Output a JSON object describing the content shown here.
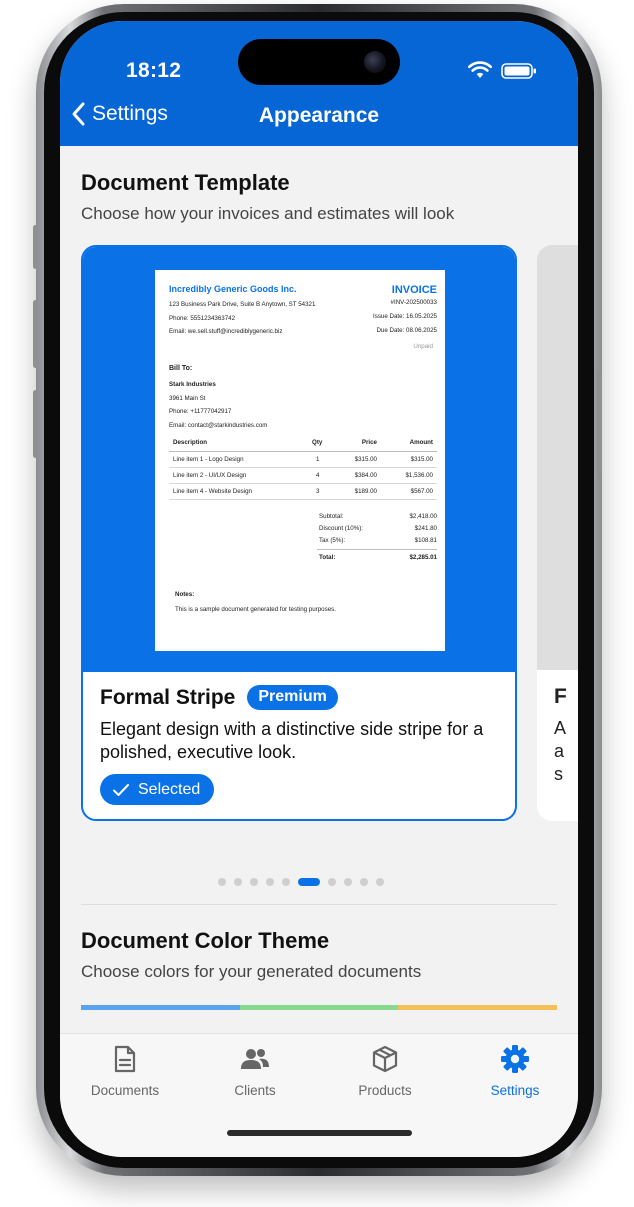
{
  "status": {
    "time": "18:12"
  },
  "nav": {
    "back_label": "Settings",
    "title": "Appearance"
  },
  "template_section": {
    "title": "Document Template",
    "subtitle": "Choose how your invoices and estimates will look"
  },
  "card": {
    "name": "Formal Stripe",
    "badge": "Premium",
    "description": "Elegant design with a distinctive side stripe for a polished, executive look.",
    "selected_label": "Selected",
    "next_card_fragments": [
      "F",
      "A",
      "a",
      "s"
    ]
  },
  "invoice": {
    "company": "Incredibly Generic Goods Inc.",
    "address": "123 Business Park Drive, Suite B Anytown, ST 54321",
    "phone": "Phone: 5551234363742",
    "email": "Email: we.sell.stuff@incrediblygeneric.biz",
    "title": "INVOICE",
    "number": "#INV-202500033",
    "issue_date": "Issue Date: 16.05.2025",
    "due_date": "Due Date: 08.06.2025",
    "status": "Unpaid",
    "bill_to_label": "Bill To:",
    "client_name": "Stark Industries",
    "client_address": "3961 Main St",
    "client_phone": "Phone: +11777042917",
    "client_email": "Email: contact@starkindustries.com",
    "headers": {
      "description": "Description",
      "qty": "Qty",
      "price": "Price",
      "amount": "Amount"
    },
    "items": [
      {
        "description": "Line item 1 - Logo Design",
        "qty": "1",
        "price": "$315.00",
        "amount": "$315.00"
      },
      {
        "description": "Line item 2 - UI/UX Design",
        "qty": "4",
        "price": "$384.00",
        "amount": "$1,536.00"
      },
      {
        "description": "Line item 4 - Website Design",
        "qty": "3",
        "price": "$189.00",
        "amount": "$567.00"
      }
    ],
    "totals": {
      "subtotal_label": "Subtotal:",
      "subtotal": "$2,418.00",
      "discount_label": "Discount (10%):",
      "discount": "$241.80",
      "tax_label": "Tax (5%):",
      "tax": "$108.81",
      "total_label": "Total:",
      "total": "$2,285.01"
    },
    "notes_label": "Notes:",
    "notes": "This is a sample document generated for testing purposes."
  },
  "pagination": {
    "count": 10,
    "active_index": 5
  },
  "color_section": {
    "title": "Document Color Theme",
    "subtitle": "Choose colors for your generated documents",
    "strip_colors": [
      "#5aa3f0",
      "#86d98f",
      "#f2bf58"
    ]
  },
  "tabs": [
    {
      "label": "Documents",
      "icon": "document-icon"
    },
    {
      "label": "Clients",
      "icon": "people-icon"
    },
    {
      "label": "Products",
      "icon": "box-icon"
    },
    {
      "label": "Settings",
      "icon": "gear-icon"
    }
  ],
  "active_tab": "Settings",
  "colors": {
    "accent": "#0a72e6",
    "header": "#0766d6"
  }
}
